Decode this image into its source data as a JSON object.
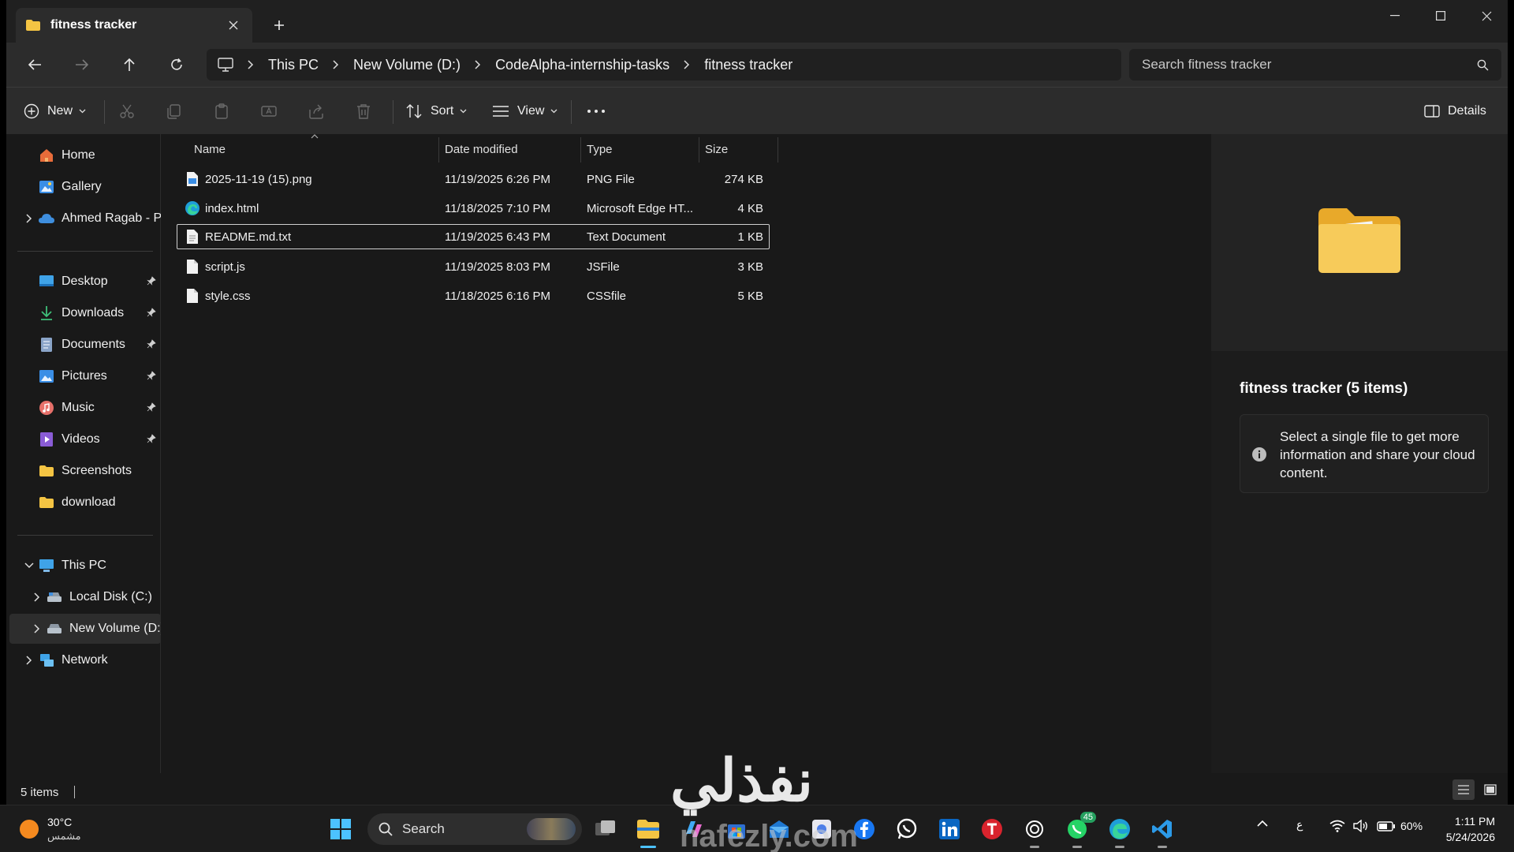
{
  "tab": {
    "title": "fitness tracker"
  },
  "nav": {
    "back": "back",
    "forward": "forward",
    "up": "up",
    "refresh": "refresh"
  },
  "breadcrumb": [
    "This PC",
    "New Volume (D:)",
    "CodeAlpha-internship-tasks",
    "fitness tracker"
  ],
  "search": {
    "placeholder": "Search fitness tracker"
  },
  "toolbar": {
    "new_label": "New",
    "sort_label": "Sort",
    "view_label": "View",
    "details_label": "Details"
  },
  "sidebar": {
    "quick": [
      {
        "label": "Home",
        "icon": "home-icon"
      },
      {
        "label": "Gallery",
        "icon": "gallery-icon"
      },
      {
        "label": "Ahmed Ragab - Personal",
        "icon": "onedrive-icon"
      }
    ],
    "pinned": [
      {
        "label": "Desktop",
        "icon": "desktop-icon"
      },
      {
        "label": "Downloads",
        "icon": "downloads-icon"
      },
      {
        "label": "Documents",
        "icon": "documents-icon"
      },
      {
        "label": "Pictures",
        "icon": "pictures-icon"
      },
      {
        "label": "Music",
        "icon": "music-icon"
      },
      {
        "label": "Videos",
        "icon": "videos-icon"
      },
      {
        "label": "Screenshots",
        "icon": "folder-icon"
      },
      {
        "label": "download",
        "icon": "folder-icon"
      }
    ],
    "tree": [
      {
        "label": "This PC",
        "icon": "this-pc-icon"
      },
      {
        "label": "Local Disk (C:)",
        "icon": "drive-icon"
      },
      {
        "label": "New Volume (D:)",
        "icon": "drive-icon"
      },
      {
        "label": "Network",
        "icon": "network-icon"
      }
    ]
  },
  "columns": {
    "name": "Name",
    "date": "Date modified",
    "type": "Type",
    "size": "Size"
  },
  "files": [
    {
      "name": "2025-11-19 (15).png",
      "date": "11/19/2025 6:26 PM",
      "type": "PNG File",
      "size": "274 KB",
      "icon": "png-file-icon"
    },
    {
      "name": "index.html",
      "date": "11/18/2025 7:10 PM",
      "type": "Microsoft Edge HT...",
      "size": "4 KB",
      "icon": "edge-icon"
    },
    {
      "name": "README.md.txt",
      "date": "11/19/2025 6:43 PM",
      "type": "Text Document",
      "size": "1 KB",
      "icon": "text-file-icon"
    },
    {
      "name": "script.js",
      "date": "11/19/2025 8:03 PM",
      "type": "JSFile",
      "size": "3 KB",
      "icon": "file-icon"
    },
    {
      "name": "style.css",
      "date": "11/18/2025 6:16 PM",
      "type": "CSSfile",
      "size": "5 KB",
      "icon": "file-icon"
    }
  ],
  "details": {
    "title": "fitness tracker (5 items)",
    "info": "Select a single file to get more information and share your cloud content."
  },
  "status": {
    "items": "5 items"
  },
  "taskbar": {
    "weather_temp": "30°C",
    "weather_cond": "مشمس",
    "search_label": "Search",
    "whatsapp_badge": "45",
    "lang": "ع",
    "battery": "60%",
    "time": "1:11 PM",
    "date": "5/24/2026"
  },
  "watermark": {
    "arabic": "نفذلي",
    "latin": "nafezly.com"
  },
  "colors": {
    "folder": "#f4c443",
    "accent": "#0078d4",
    "bg": "#191919"
  }
}
